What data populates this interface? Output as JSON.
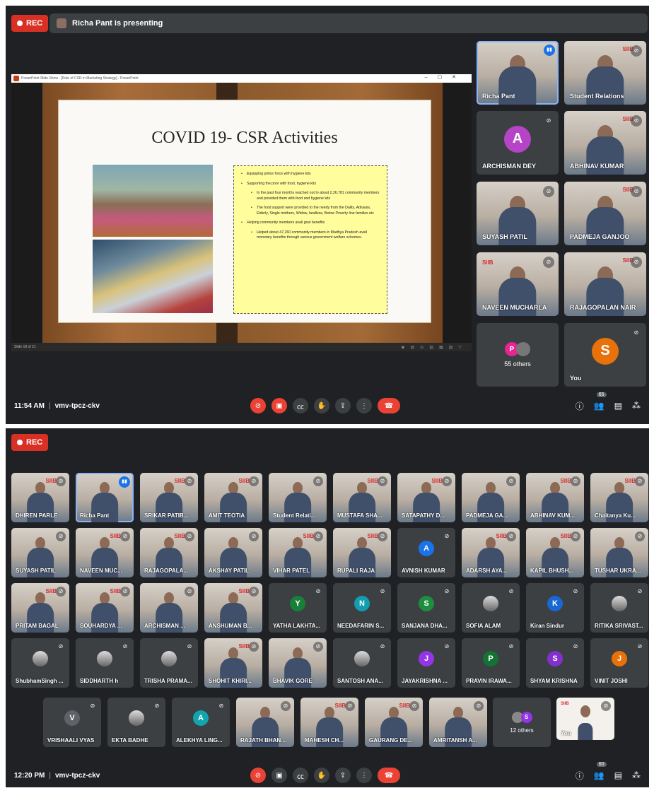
{
  "top": {
    "rec_label": "REC",
    "presenting_banner": "Richa Pant is presenting",
    "slide_window_title": "PowerPoint Slide Show - [Role of CSR in Marketing Strategy] - PowerPoint",
    "slide_title": "COVID 19- CSR Activities",
    "slide_bullets": [
      "Equipping police force with hygiene kits",
      "Supporting the poor with food, hygiene kits",
      "In the past four months reached out to about 2,26,781 community members and provided them with food and hygiene kits",
      "The food support were provided to the needy from the Dalits, Adivasis, Elderly, Single mothers, Widow, landless, Below Poverty line families etc",
      "Helping community members avail govt benefits",
      "Helped about 47,260 community members in Madhya Pradesh avail monetary benefits through various government welfare schemes."
    ],
    "slide_status": "Slide 18 of 21",
    "tiles": [
      {
        "name": "Richa Pant",
        "kind": "cam",
        "speaking": true
      },
      {
        "name": "Student Relations",
        "kind": "cam"
      },
      {
        "name": "ARCHISMAN DEY",
        "kind": "avatar",
        "letter": "A",
        "color": "#b544c7"
      },
      {
        "name": "ABHINAV KUMAR",
        "kind": "cam"
      },
      {
        "name": "SUYASH PATIL",
        "kind": "cam"
      },
      {
        "name": "PADMEJA GANJOO",
        "kind": "cam"
      },
      {
        "name": "NAVEEN MUCHARLA",
        "kind": "cam"
      },
      {
        "name": "RAJAGOPALAN NAIR",
        "kind": "cam"
      }
    ],
    "others_label": "55 others",
    "others_letter": "P",
    "you_label": "You",
    "you_letter": "S",
    "time": "11:54 AM",
    "meeting_code": "vmv-tpcz-ckv",
    "people_count": "65"
  },
  "bottom": {
    "rec_label": "REC",
    "tiles": [
      {
        "name": "DHIREN PARLE",
        "kind": "cam"
      },
      {
        "name": "Richa Pant",
        "kind": "cam",
        "speaking": true
      },
      {
        "name": "SRIKAR PATIB...",
        "kind": "cam"
      },
      {
        "name": "AMIT TEOTIA",
        "kind": "cam"
      },
      {
        "name": "Student Relati...",
        "kind": "cam"
      },
      {
        "name": "MUSTAFA SHA...",
        "kind": "cam"
      },
      {
        "name": "SATAPATHY D...",
        "kind": "cam"
      },
      {
        "name": "PADMEJA GA...",
        "kind": "cam"
      },
      {
        "name": "ABHINAV KUM...",
        "kind": "cam"
      },
      {
        "name": "Chaitanya Ku...",
        "kind": "cam"
      },
      {
        "name": "SUYASH PATIL",
        "kind": "cam"
      },
      {
        "name": "NAVEEN MUC...",
        "kind": "cam"
      },
      {
        "name": "RAJAGOPALA...",
        "kind": "cam"
      },
      {
        "name": "AKSHAY PATIL",
        "kind": "cam"
      },
      {
        "name": "VIHAR PATEL",
        "kind": "cam"
      },
      {
        "name": "RUPALI RAJA",
        "kind": "cam"
      },
      {
        "name": "AVNISH KUMAR",
        "kind": "avatar",
        "letter": "A",
        "color": "#1a73e8"
      },
      {
        "name": "ADARSH AYA...",
        "kind": "cam"
      },
      {
        "name": "KAPIL BHUSH...",
        "kind": "cam"
      },
      {
        "name": "TUSHAR UKRA...",
        "kind": "cam"
      },
      {
        "name": "PRITAM BAGAL",
        "kind": "cam"
      },
      {
        "name": "SOUHARDYA ...",
        "kind": "cam"
      },
      {
        "name": "ARCHISMAN ...",
        "kind": "cam"
      },
      {
        "name": "ANSHUMAN B...",
        "kind": "cam"
      },
      {
        "name": "YATHA LAKHTA...",
        "kind": "avatar",
        "letter": "Y",
        "color": "#188038"
      },
      {
        "name": "NEEDAFARIN S...",
        "kind": "avatar",
        "letter": "N",
        "color": "#129eaf"
      },
      {
        "name": "SANJANA DHA...",
        "kind": "avatar",
        "letter": "S",
        "color": "#1e8e3e"
      },
      {
        "name": "SOFIA ALAM",
        "kind": "photo"
      },
      {
        "name": "Kiran Sindur",
        "kind": "avatar",
        "letter": "K",
        "color": "#1967d2"
      },
      {
        "name": "RITIKA SRIVAST...",
        "kind": "photo"
      },
      {
        "name": "ShubhamSingh ...",
        "kind": "photo"
      },
      {
        "name": "SIDDHARTH h",
        "kind": "photo"
      },
      {
        "name": "TRISHA PRAMA...",
        "kind": "photo"
      },
      {
        "name": "SHOHIT KHIRI...",
        "kind": "cam"
      },
      {
        "name": "BHAVIK GORE",
        "kind": "cam"
      },
      {
        "name": "SANTOSH ANA...",
        "kind": "photo"
      },
      {
        "name": "JAYAKRISHNA ...",
        "kind": "avatar",
        "letter": "J",
        "color": "#9334e6"
      },
      {
        "name": "PRAVIN IRAWA...",
        "kind": "avatar",
        "letter": "P",
        "color": "#137333"
      },
      {
        "name": "SHYAM KRISHNA",
        "kind": "avatar",
        "letter": "S",
        "color": "#8430ce"
      },
      {
        "name": "VINIT JOSHI",
        "kind": "avatar",
        "letter": "J",
        "color": "#e8710a"
      },
      {
        "name": "VRISHAALI VYAS",
        "kind": "avatar",
        "letter": "V",
        "color": "#5f6368"
      },
      {
        "name": "EKTA BADHE",
        "kind": "photo"
      },
      {
        "name": "ALEKHYA LING...",
        "kind": "avatar",
        "letter": "A",
        "color": "#12a4af"
      },
      {
        "name": "RAJATH BHAN...",
        "kind": "cam"
      },
      {
        "name": "MAHESH CH...",
        "kind": "cam"
      },
      {
        "name": "GAURANG DE...",
        "kind": "cam"
      },
      {
        "name": "AMRITANSH A...",
        "kind": "cam"
      }
    ],
    "others_label": "12 others",
    "others_letter": "S",
    "you_label": "You",
    "time": "12:20 PM",
    "meeting_code": "vmv-tpcz-ckv",
    "people_count": "60"
  },
  "icons": {
    "mic_off": "🎙",
    "brand": "SIIB",
    "accent": "#8ab4f8",
    "end_call_color": "#ea4335"
  }
}
